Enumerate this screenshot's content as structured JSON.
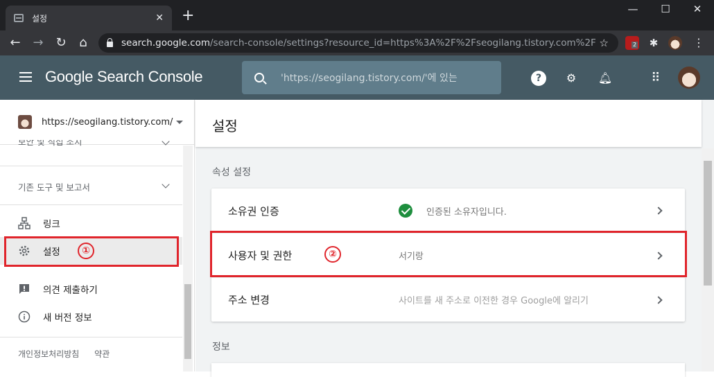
{
  "browser": {
    "tab_title": "설정",
    "tab_close": "✕",
    "new_tab": "+",
    "url_host": "search.google.com",
    "url_path": "/search-console/settings?resource_id=https%3A%2F%2Fseogilang.tistory.com%2F",
    "ext_badge": "2"
  },
  "header": {
    "brand": "Google Search Console",
    "search_placeholder": "'https://seogilang.tistory.com/'에 있는"
  },
  "sidebar": {
    "property": "https://seogilang.tistory.com/",
    "sections": [
      {
        "label": "보안 및 직접 조치"
      },
      {
        "label": "기존 도구 및 보고서"
      }
    ],
    "items": [
      {
        "label": "링크",
        "icon": "link-tree-icon"
      },
      {
        "label": "설정",
        "icon": "gear-icon"
      },
      {
        "label": "의견 제출하기",
        "icon": "feedback-icon"
      },
      {
        "label": "새 버전 정보",
        "icon": "info-icon"
      }
    ],
    "footer": [
      "개인정보처리방침",
      "약관"
    ]
  },
  "main": {
    "title": "설정",
    "property_settings_heading": "속성 설정",
    "rows": [
      {
        "label": "소유권 인증",
        "value": "인증된 소유자입니다."
      },
      {
        "label": "사용자 및 권한",
        "value": "서기랑"
      },
      {
        "label": "주소 변경",
        "value": "사이트를 새 주소로 이전한 경우 Google에 알리기"
      }
    ],
    "info_heading": "정보"
  },
  "annotations": {
    "mark1": "①",
    "mark2": "②",
    "color": "#e0242b"
  },
  "colors": {
    "header_bg": "#455a64",
    "verified_green": "#1e8e3e"
  }
}
